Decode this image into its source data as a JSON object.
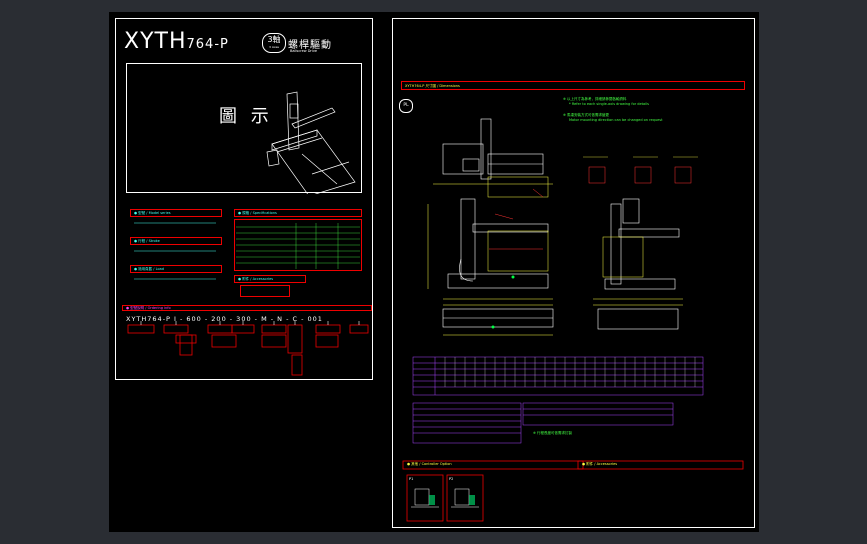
{
  "left": {
    "model": "XYTH",
    "model_suffix": "764-P",
    "axes_badge": "3軸",
    "axes_badge_sub": "3 Axes",
    "drive_cn": "螺桿驅動",
    "drive_en": "Ballscrew Drive",
    "illustration_label": "圖 示",
    "sections": {
      "s1": "● 型號 / Model series",
      "s2": "● 行程 / Stroke",
      "s3": "● 適用負載 / Load",
      "s4": "● 規格 / Specifications",
      "s5": "● 附件 / Accessories",
      "order": "● 型號說明 / Ordering info"
    },
    "order_code": "XYTH764-P  I - 600 - 200 - 300 - M - N - C - 001"
  },
  "right": {
    "header": "XYTH764-P 尺寸圖 / Dimensions",
    "note_lines": [
      "※ 以上尺寸為參考，詳細請參閱各軸資料",
      "* Refer to each single-axis drawing for details",
      "※ 馬達安裝方式可依需求變更",
      "Motor mounting direction can be changed on request"
    ],
    "label_pl": "PL",
    "table_note": "※ 行程長度可依需求訂製",
    "bottom_left": "● 其他 / Controller Option",
    "bottom_right": "● 附件 / Accessories",
    "p1": "P1",
    "p2": "P2"
  }
}
